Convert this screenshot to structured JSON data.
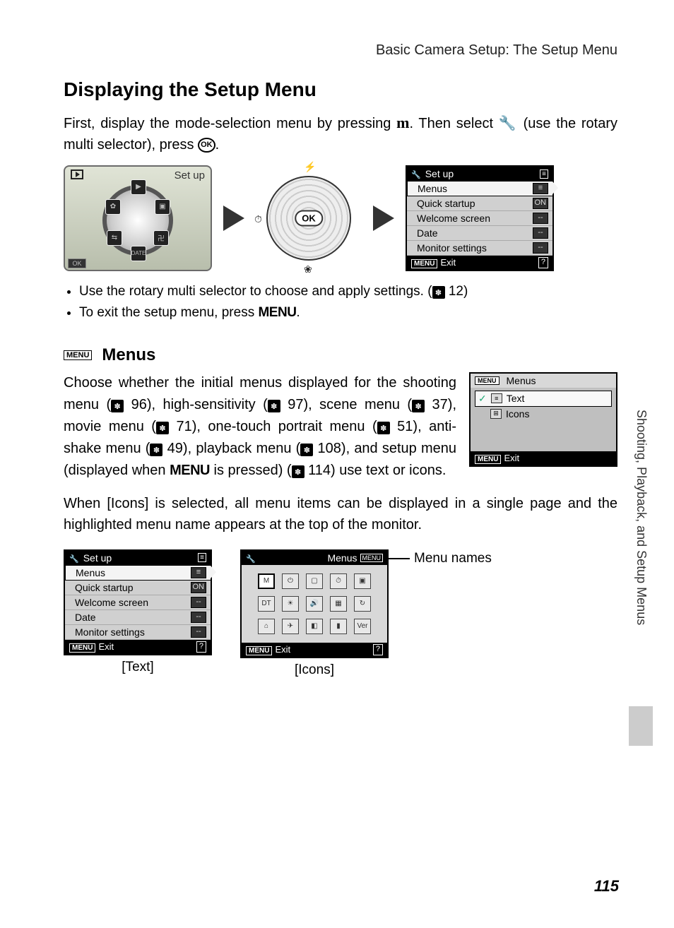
{
  "header": "Basic Camera Setup: The Setup Menu",
  "section_title": "Displaying the Setup Menu",
  "intro_1": "First, display the mode-selection menu by pressing ",
  "intro_mode_icon": "m",
  "intro_2": ". Then select ",
  "intro_wrench": "🔧",
  "intro_3": " (use the rotary multi selector), press ",
  "intro_ok": "OK",
  "intro_4": ".",
  "mode_screen_label": "Set up",
  "rotary": {
    "ok": "OK"
  },
  "setup_screen": {
    "title": "Set up",
    "rows": [
      {
        "label": "Menus",
        "val": "≡",
        "selected": true
      },
      {
        "label": "Quick startup",
        "val": "ON"
      },
      {
        "label": "Welcome screen",
        "val": "--"
      },
      {
        "label": "Date",
        "val": "--"
      },
      {
        "label": "Monitor settings",
        "val": "--"
      }
    ],
    "exit": "Exit"
  },
  "bullets": [
    {
      "text_a": "Use the rotary multi selector to choose and apply settings. (",
      "ref": "12",
      "text_b": ")"
    },
    {
      "text_a": "To exit the setup menu, press ",
      "menu": "MENU",
      "text_b": "."
    }
  ],
  "subhead": "Menus",
  "menus_para_parts": {
    "p1": "Choose whether the initial menus displayed for the shooting menu (",
    "r1": "96",
    "p2": "), high-sensitivity (",
    "r2": "97",
    "p3": "), scene menu (",
    "r3": "37",
    "p4": "), movie menu (",
    "r4": "71",
    "p5": "), one-touch portrait menu (",
    "r5": "51",
    "p6": "), anti-shake menu (",
    "r6": "49",
    "p7": "), playback menu (",
    "r7": "108",
    "p8": "), and setup menu (displayed when ",
    "menu": "MENU",
    "p9": " is pressed) (",
    "r8": "114",
    "p10": ") use text or icons."
  },
  "menus_small_screen": {
    "title": "Menus",
    "opt_text": "Text",
    "opt_icons": "Icons",
    "exit": "Exit"
  },
  "icons_para": "When [Icons] is selected, all menu items can be displayed in a single page and the highlighted menu name appears at the top of the monitor.",
  "text_example": {
    "title": "Set up",
    "rows": [
      {
        "label": "Menus",
        "val": "≡",
        "selected": true
      },
      {
        "label": "Quick startup",
        "val": "ON"
      },
      {
        "label": "Welcome screen",
        "val": "--"
      },
      {
        "label": "Date",
        "val": "--"
      },
      {
        "label": "Monitor settings",
        "val": "--"
      }
    ],
    "exit": "Exit",
    "caption": "[Text]"
  },
  "icons_example": {
    "title_right": "Menus",
    "exit": "Exit",
    "caption": "[Icons]"
  },
  "callout": "Menu names",
  "side_tab": "Shooting, Playback, and Setup Menus",
  "page_num": "115"
}
